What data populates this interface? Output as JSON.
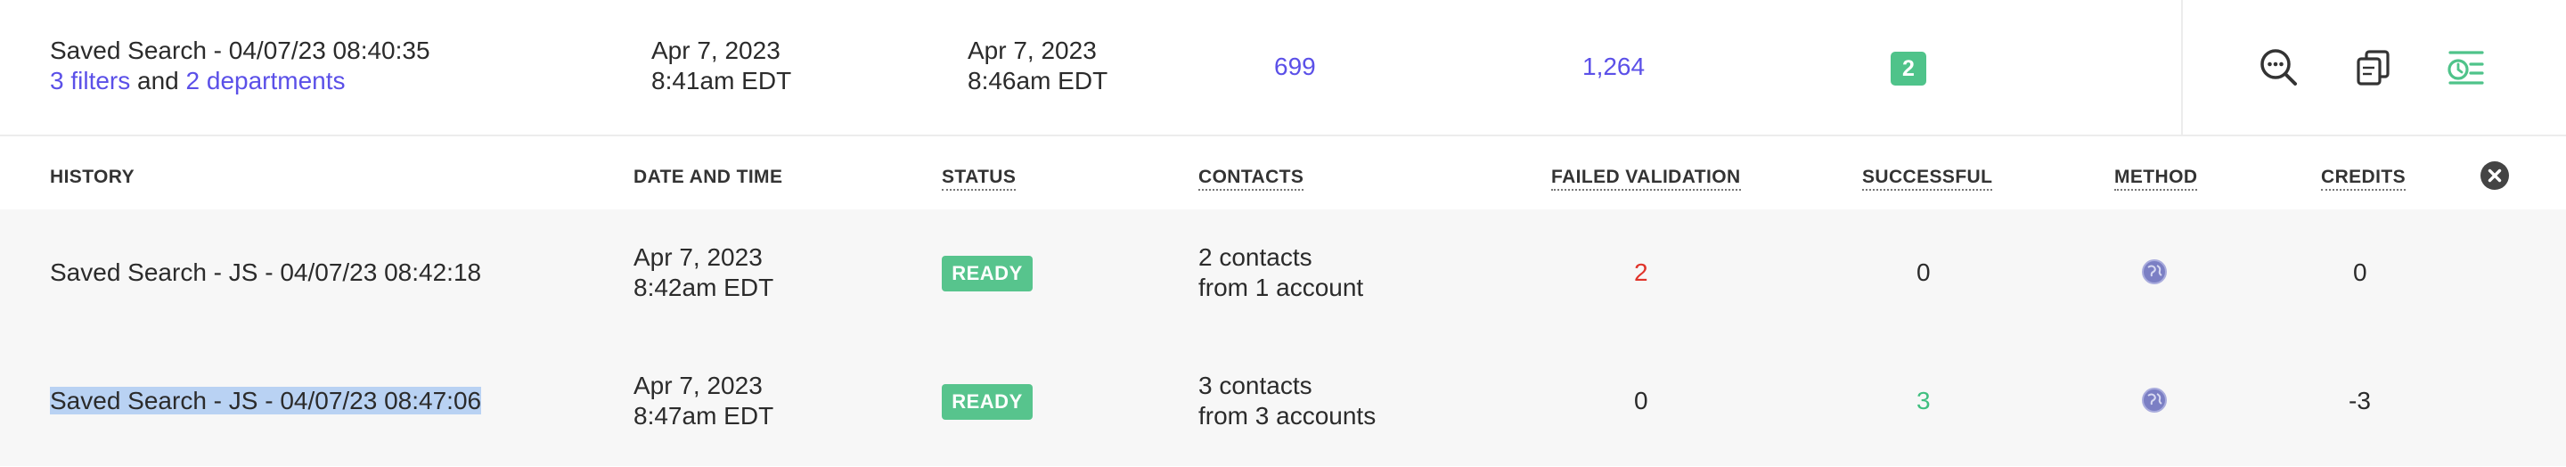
{
  "summary": {
    "title": "Saved Search - 04/07/23 08:40:35",
    "filters_link": "3 filters",
    "and_text": "and",
    "departments_link": "2 departments",
    "created_date": "Apr 7, 2023",
    "created_time": "8:41am EDT",
    "updated_date": "Apr 7, 2023",
    "updated_time": "8:46am EDT",
    "count_a": "699",
    "count_b": "1,264",
    "badge": "2",
    "accent_color": "#5b50e8",
    "badge_color": "#4fc38a",
    "actions": [
      {
        "icon": "search-comment-icon"
      },
      {
        "icon": "copy-icon"
      },
      {
        "icon": "history-list-icon",
        "active": true
      }
    ]
  },
  "history": {
    "columns": {
      "history": "HISTORY",
      "date_time": "DATE AND TIME",
      "status": "STATUS",
      "contacts": "CONTACTS",
      "failed": "FAILED VALIDATION",
      "successful": "SUCCESSFUL",
      "method": "METHOD",
      "credits": "CREDITS"
    },
    "close_icon": "close-icon",
    "rows": [
      {
        "name": "Saved Search - JS - 04/07/23 08:42:18",
        "date": "Apr 7, 2023",
        "time": "8:42am EDT",
        "status": "READY",
        "contacts_line1": "2 contacts",
        "contacts_line2": "from 1 account",
        "failed": "2",
        "successful": "0",
        "method_icon": "globe-icon",
        "credits": "0"
      },
      {
        "name": "Saved Search - JS - 04/07/23 08:47:06",
        "date": "Apr 7, 2023",
        "time": "8:47am EDT",
        "status": "READY",
        "contacts_line1": "3 contacts",
        "contacts_line2": "from 3 accounts",
        "failed": "0",
        "successful": "3",
        "method_icon": "globe-icon",
        "credits": "-3"
      }
    ]
  }
}
